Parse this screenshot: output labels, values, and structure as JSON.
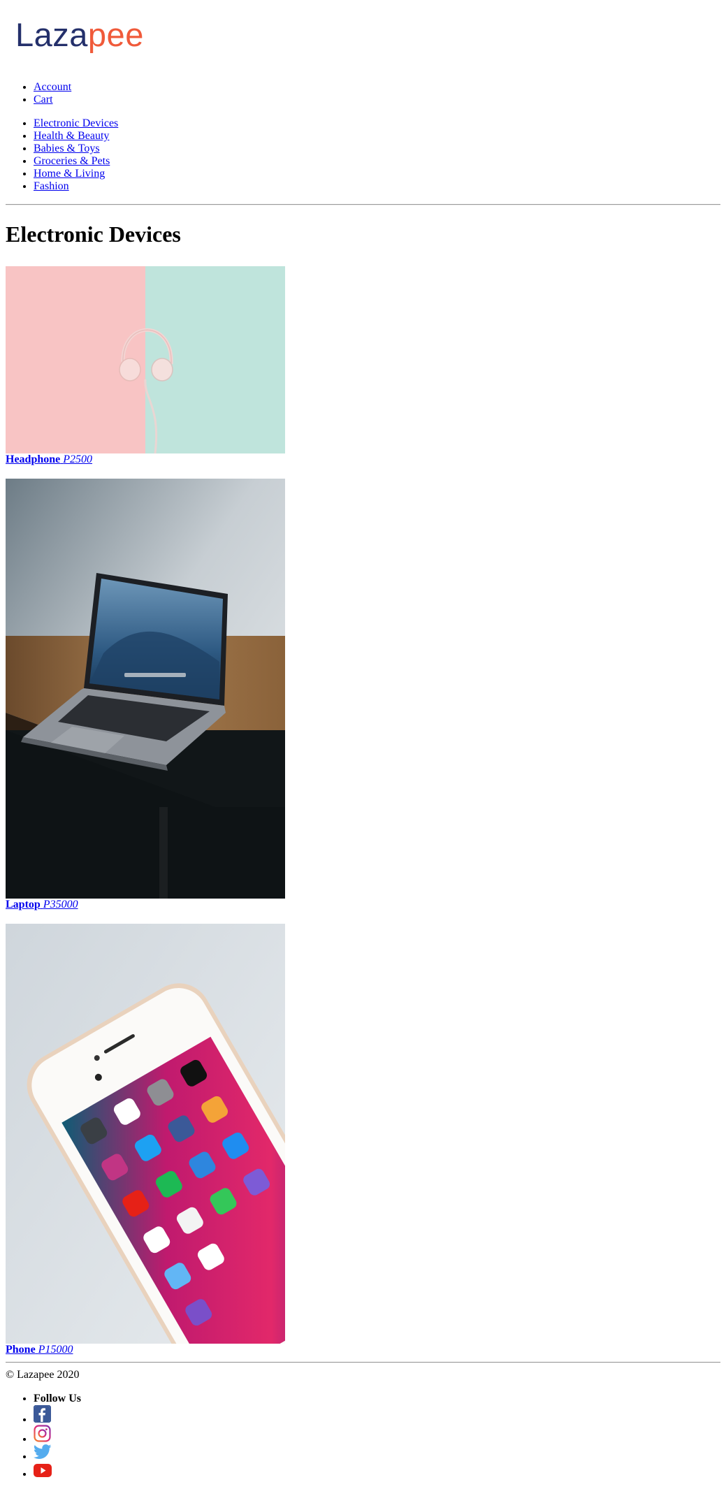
{
  "brand": {
    "logo_part1": "Laza",
    "logo_part2": "pee",
    "color_dark": "#24306b",
    "color_accent": "#f05a3a"
  },
  "top_nav": [
    {
      "label": "Account"
    },
    {
      "label": "Cart"
    }
  ],
  "categories": [
    {
      "label": "Electronic Devices"
    },
    {
      "label": "Health & Beauty"
    },
    {
      "label": "Babies & Toys"
    },
    {
      "label": "Groceries & Pets"
    },
    {
      "label": "Home & Living"
    },
    {
      "label": "Fashion"
    }
  ],
  "page": {
    "title": "Electronic Devices"
  },
  "products": [
    {
      "name": "Headphone",
      "price": "P2500",
      "image_icon": "headphone-photo"
    },
    {
      "name": "Laptop",
      "price": "P35000",
      "image_icon": "laptop-photo"
    },
    {
      "name": "Phone",
      "price": "P15000",
      "image_icon": "phone-photo"
    }
  ],
  "footer": {
    "copyright": "© Lazapee 2020",
    "follow_label": "Follow Us",
    "social": [
      {
        "icon": "facebook-icon",
        "color": "#3b5998"
      },
      {
        "icon": "instagram-icon",
        "color": "#c13584"
      },
      {
        "icon": "twitter-icon",
        "color": "#55acee"
      },
      {
        "icon": "youtube-icon",
        "color": "#e62117"
      }
    ]
  }
}
